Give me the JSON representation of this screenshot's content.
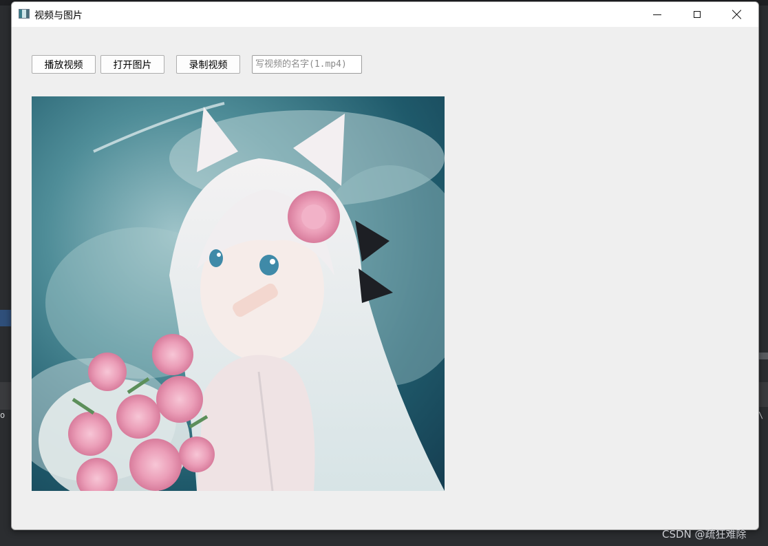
{
  "window": {
    "title": "视频与图片"
  },
  "toolbar": {
    "play_video_label": "播放视频",
    "open_image_label": "打开图片",
    "record_video_label": "录制视频",
    "video_name_placeholder": "写视频的名字(1.mp4)",
    "video_name_value": ""
  },
  "image": {
    "description_icon": "anime-illustration-image"
  },
  "background": {
    "left_text": "o",
    "right_text": "\\",
    "watermark": "CSDN @疏狂难除"
  },
  "colors": {
    "window_bg": "#efefef",
    "titlebar_bg": "#ffffff",
    "button_border": "#adadad",
    "image_sky": "#2d6675"
  }
}
